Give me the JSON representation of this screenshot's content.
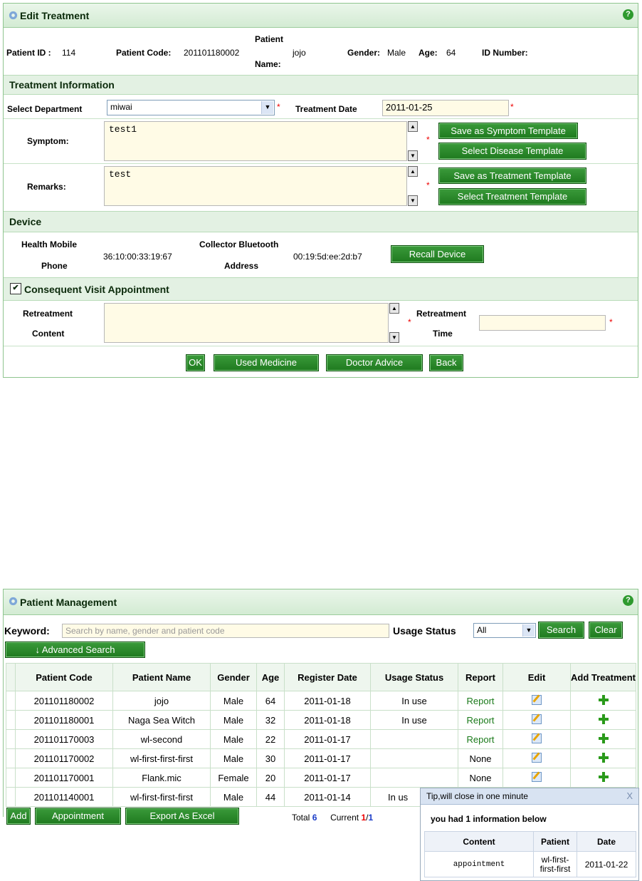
{
  "edit_treatment": {
    "title": "Edit Treatment",
    "patient": {
      "id_label": "Patient ID :",
      "id_value": "114",
      "code_label": "Patient Code:",
      "code_value": "201101180002",
      "name_label_1": "Patient",
      "name_label_2": "Name:",
      "name_value": "jojo",
      "gender_label": "Gender:",
      "gender_value": "Male",
      "age_label": "Age:",
      "age_value": "64",
      "idnum_label": "ID Number:",
      "idnum_value": ""
    },
    "treatment_section": "Treatment Information",
    "dept_label": "Select Department",
    "dept_value": "miwai",
    "date_label": "Treatment Date",
    "date_value": "2011-01-25",
    "symptom_label": "Symptom:",
    "symptom_value": "test1",
    "remarks_label": "Remarks:",
    "remarks_value": "test",
    "btn_save_symptom": "Save as Symptom Template",
    "btn_select_disease": "Select Disease Template",
    "btn_save_treatment": "Save as Treatment Template",
    "btn_select_treatment": "Select Treatment Template",
    "device_section": "Device",
    "phone_label_1": "Health Mobile",
    "phone_label_2": "Phone",
    "phone_value": "36:10:00:33:19:67",
    "bt_label_1": "Collector Bluetooth",
    "bt_label_2": "Address",
    "bt_value": "00:19:5d:ee:2d:b7",
    "btn_recall": "Recall Device",
    "visit_section": "Consequent Visit Appointment",
    "visit_checked": true,
    "retreat_content_label_1": "Retreatment",
    "retreat_content_label_2": "Content",
    "retreat_content_value": "",
    "retreat_time_label_1": "Retreatment",
    "retreat_time_label_2": "Time",
    "retreat_time_value": "",
    "btn_ok": "OK",
    "btn_used_medicine": "Used Medicine",
    "btn_doctor_advice": "Doctor Advice",
    "btn_back": "Back",
    "required_mark": "*"
  },
  "patient_mgmt": {
    "title": "Patient Management",
    "keyword_label": "Keyword:",
    "keyword_placeholder": "Search by name, gender and patient code",
    "usage_label": "Usage Status",
    "usage_value": "All",
    "btn_search": "Search",
    "btn_clear": "Clear",
    "btn_advanced": "↓ Advanced Search",
    "columns": [
      "Patient Code",
      "Patient Name",
      "Gender",
      "Age",
      "Register Date",
      "Usage Status",
      "Report",
      "Edit",
      "Add Treatment"
    ],
    "rows": [
      {
        "code": "201101180002",
        "name": "jojo",
        "gender": "Male",
        "age": "64",
        "date": "2011-01-18",
        "status": "In use",
        "report": "Report"
      },
      {
        "code": "201101180001",
        "name": "Naga Sea Witch",
        "gender": "Male",
        "age": "32",
        "date": "2011-01-18",
        "status": "In use",
        "report": "Report"
      },
      {
        "code": "201101170003",
        "name": "wl-second",
        "gender": "Male",
        "age": "22",
        "date": "2011-01-17",
        "status": "",
        "report": "Report"
      },
      {
        "code": "201101170002",
        "name": "wl-first-first-first",
        "gender": "Male",
        "age": "30",
        "date": "2011-01-17",
        "status": "",
        "report": "None"
      },
      {
        "code": "201101170001",
        "name": "Flank.mic",
        "gender": "Female",
        "age": "20",
        "date": "2011-01-17",
        "status": "",
        "report": "None"
      },
      {
        "code": "201101140001",
        "name": "wl-first-first-first",
        "gender": "Male",
        "age": "44",
        "date": "2011-01-14",
        "status": "In us",
        "report": ""
      }
    ],
    "btn_add": "Add",
    "btn_appointment": "Appointment",
    "btn_export": "Export As Excel",
    "total_label": "Total",
    "total_value": "6",
    "current_label": "Current",
    "current_page": "1",
    "page_sep": "/",
    "page_total": "1"
  },
  "tip_popup": {
    "title": "Tip,will close in one minute",
    "close": "X",
    "message": "you had 1 information below",
    "columns": [
      "Content",
      "Patient",
      "Date"
    ],
    "row": {
      "content": "appointment",
      "patient_1": "wl-first-",
      "patient_2": "first-first",
      "date": "2011-01-22"
    }
  },
  "colors": {
    "accent_green": "#1f7a1f",
    "section_bg": "#e3f1e3",
    "field_bg": "#fffbe6",
    "required": "#e00000"
  }
}
